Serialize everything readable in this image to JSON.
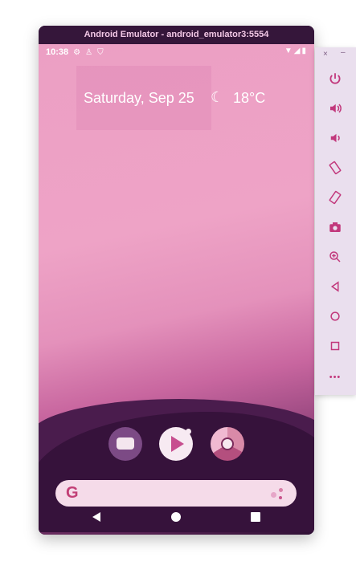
{
  "window": {
    "title": "Android Emulator - android_emulator3:5554"
  },
  "status_bar": {
    "time": "10:38",
    "left_icons": [
      "gear-icon",
      "bug-icon",
      "shield-icon"
    ],
    "right_icons": [
      "wifi-icon",
      "signal-icon",
      "battery-icon"
    ]
  },
  "widget": {
    "date": "Saturday, Sep 25",
    "weather_icon": "moon-icon",
    "temperature": "18°C"
  },
  "dock": {
    "apps": [
      "messages-icon",
      "play-store-icon",
      "chrome-icon"
    ]
  },
  "search": {
    "logo": "G",
    "assistant_icon": "assistant-icon"
  },
  "nav_bar": {
    "buttons": [
      "back-button",
      "home-button",
      "recents-button"
    ]
  },
  "side_panel": {
    "window_controls": [
      "×",
      "–"
    ],
    "buttons": [
      "power",
      "volume-up",
      "volume-down",
      "rotate-left",
      "rotate-right",
      "screenshot",
      "zoom",
      "back",
      "home",
      "overview",
      "more"
    ],
    "more_label": "•••"
  },
  "colors": {
    "frame": "#35163a",
    "title_text": "#f3c8e6",
    "accent": "#c2387c",
    "panel": "#eadfee",
    "wallpaper_top": "#ec9fc4"
  }
}
